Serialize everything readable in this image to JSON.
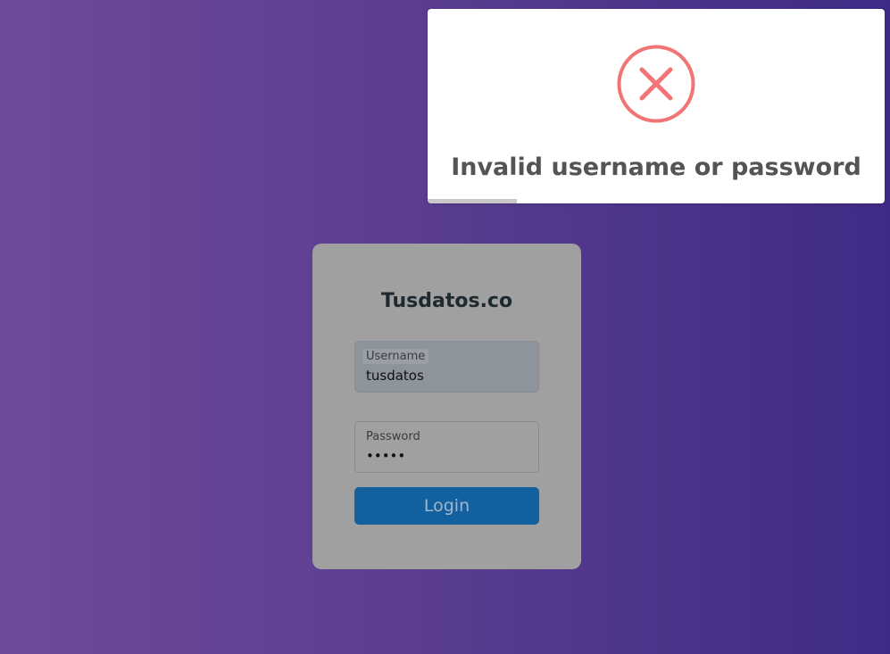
{
  "login": {
    "title": "Tusdatos.co",
    "username_label": "Username",
    "username_value": "tusdatos",
    "password_label": "Password",
    "password_value": "•••••",
    "login_button": "Login"
  },
  "toast": {
    "icon": "error-x-circle-icon",
    "icon_color": "#f27474",
    "message": "Invalid username or password",
    "progress_fraction": 0.195
  },
  "colors": {
    "background_gradient_start": "#6f4b9b",
    "background_gradient_end": "#3f2b86",
    "card_background": "#a0a0a0",
    "login_button": "#12609e"
  }
}
